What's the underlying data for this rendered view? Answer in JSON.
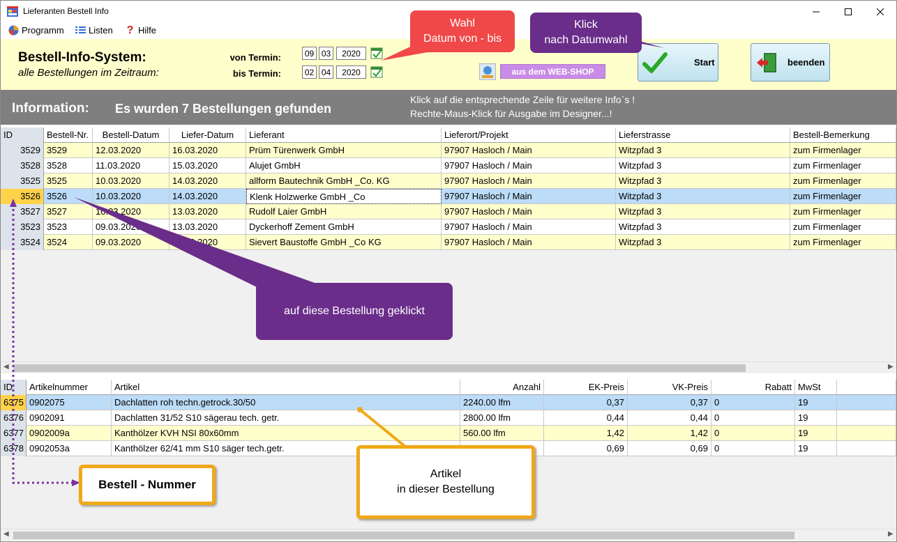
{
  "window": {
    "title": "Lieferanten Bestell Info"
  },
  "menu": {
    "programm": "Programm",
    "listen": "Listen",
    "hilfe": "Hilfe"
  },
  "header": {
    "title": "Bestell-Info-System:",
    "subtitle": "alle Bestellungen im Zeitraum:",
    "von_label": "von Termin:",
    "bis_label": "bis Termin:",
    "von": {
      "day": "09",
      "month": "03",
      "year": "2020"
    },
    "bis": {
      "day": "02",
      "month": "04",
      "year": "2020"
    },
    "webshop_label": "aus dem WEB-SHOP",
    "start_label": "Start",
    "beenden_label": "beenden"
  },
  "info": {
    "label": "Information:",
    "message": "Es wurden  7  Bestellungen gefunden",
    "hint1": "Klick auf die entsprechende Zeile für weitere Info`s !",
    "hint2": "Rechte-Maus-Klick für Ausgabe im Designer...!"
  },
  "orders": {
    "columns": [
      "ID",
      "Bestell-Nr.",
      "Bestell-Datum",
      "Liefer-Datum",
      "Lieferant",
      "Lieferort/Projekt",
      "Lieferstrasse",
      "Bestell-Bemerkung"
    ],
    "rows": [
      {
        "id": "3529",
        "nr": "3529",
        "bdatum": "12.03.2020",
        "ldatum": "16.03.2020",
        "lieferant": "Prüm Türenwerk GmbH",
        "ort": "97907 Hasloch / Main",
        "strasse": "Witzpfad 3",
        "bem": "zum Firmenlager"
      },
      {
        "id": "3528",
        "nr": "3528",
        "bdatum": "11.03.2020",
        "ldatum": "15.03.2020",
        "lieferant": "Alujet GmbH",
        "ort": "97907 Hasloch / Main",
        "strasse": "Witzpfad 3",
        "bem": "zum Firmenlager"
      },
      {
        "id": "3525",
        "nr": "3525",
        "bdatum": "10.03.2020",
        "ldatum": "14.03.2020",
        "lieferant": "allform Bautechnik GmbH _Co. KG",
        "ort": "97907 Hasloch / Main",
        "strasse": "Witzpfad 3",
        "bem": "zum Firmenlager"
      },
      {
        "id": "3526",
        "nr": "3526",
        "bdatum": "10.03.2020",
        "ldatum": "14.03.2020",
        "lieferant": "Klenk Holzwerke GmbH _Co",
        "ort": "97907 Hasloch / Main",
        "strasse": "Witzpfad 3",
        "bem": "zum Firmenlager"
      },
      {
        "id": "3527",
        "nr": "3527",
        "bdatum": "10.03.2020",
        "ldatum": "13.03.2020",
        "lieferant": "Rudolf Laier GmbH",
        "ort": "97907 Hasloch / Main",
        "strasse": "Witzpfad 3",
        "bem": "zum Firmenlager"
      },
      {
        "id": "3523",
        "nr": "3523",
        "bdatum": "09.03.2020",
        "ldatum": "13.03.2020",
        "lieferant": "Dyckerhoff Zement GmbH",
        "ort": "97907 Hasloch / Main",
        "strasse": "Witzpfad 3",
        "bem": "zum Firmenlager"
      },
      {
        "id": "3524",
        "nr": "3524",
        "bdatum": "09.03.2020",
        "ldatum": "13.03.2020",
        "lieferant": "Sievert Baustoffe GmbH _Co KG",
        "ort": "97907 Hasloch / Main",
        "strasse": "Witzpfad 3",
        "bem": "zum Firmenlager"
      }
    ]
  },
  "items": {
    "columns": [
      "ID",
      "Artikelnummer",
      "Artikel",
      "Anzahl",
      "EK-Preis",
      "VK-Preis",
      "Rabatt",
      "MwSt"
    ],
    "rows": [
      {
        "id": "6375",
        "nr": "0902075",
        "artikel": "Dachlatten roh techn.getrock.30/50",
        "anzahl": "2240.00 lfm",
        "ek": "0,37",
        "vk": "0,37",
        "rabatt": "0",
        "mwst": "19"
      },
      {
        "id": "6376",
        "nr": "0902091",
        "artikel": "Dachlatten 31/52 S10 sägerau tech. getr.",
        "anzahl": "2800.00 lfm",
        "ek": "0,44",
        "vk": "0,44",
        "rabatt": "0",
        "mwst": "19"
      },
      {
        "id": "6377",
        "nr": "0902009a",
        "artikel": "Kanthölzer KVH NSI 80x60mm",
        "anzahl": "560.00 lfm",
        "ek": "1,42",
        "vk": "1,42",
        "rabatt": "0",
        "mwst": "19"
      },
      {
        "id": "6378",
        "nr": "0902053a",
        "artikel": "Kanthölzer 62/41 mm S10 säger tech.getr.",
        "anzahl": "",
        "ek": "0,69",
        "vk": "0,69",
        "rabatt": "0",
        "mwst": "19"
      }
    ]
  },
  "callouts": {
    "wahl": [
      "Wahl",
      "Datum von - bis"
    ],
    "klick": [
      "Klick",
      "nach Datumwahl"
    ],
    "bestellung": "auf diese Bestellung geklickt",
    "artikel": [
      "Artikel",
      "in dieser Bestellung"
    ],
    "nummer": "Bestell - Nummer"
  },
  "colors": {
    "header_bg": "#ffffcc",
    "info_bg": "#7f7f7f",
    "selected_row": "#bcdcf8",
    "callout_red": "#f04848",
    "callout_purple": "#6a2d8a",
    "callout_orange": "#f0a818"
  }
}
